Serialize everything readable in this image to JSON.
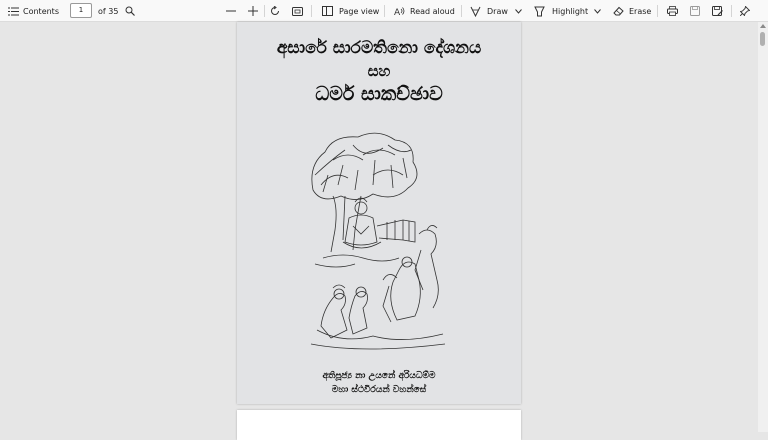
{
  "toolbar": {
    "contents_label": "Contents",
    "page_current": "1",
    "page_total": "of 35",
    "page_view_label": "Page view",
    "read_aloud_label": "Read aloud",
    "draw_label": "Draw",
    "highlight_label": "Highlight",
    "erase_label": "Erase",
    "icons": [
      "contents-icon",
      "search-icon",
      "zoom-out-icon",
      "zoom-in-icon",
      "rotate-icon",
      "fit-page-icon",
      "page-view-icon",
      "read-aloud-icon",
      "draw-icon",
      "chevron-down-icon",
      "highlight-icon",
      "chevron-down-icon",
      "eraser-icon",
      "print-icon",
      "save-icon",
      "save-as-icon",
      "pin-icon"
    ]
  },
  "document": {
    "title_line1": "අසාරේ සාරමතිනො දේශනය",
    "title_line2": "සහ",
    "title_line3": "ධර්ම සාකච්ඡාව",
    "author_line1": "අතිපූජ්‍ය නා උයනේ අරියධම්ම",
    "author_line2": "මහා ස්ථවිරයන් වහන්සේ"
  },
  "colors": {
    "page_bg": "#e2e3e5",
    "viewer_bg": "#e6e6e6",
    "toolbar_bg": "#f9f9f9"
  }
}
